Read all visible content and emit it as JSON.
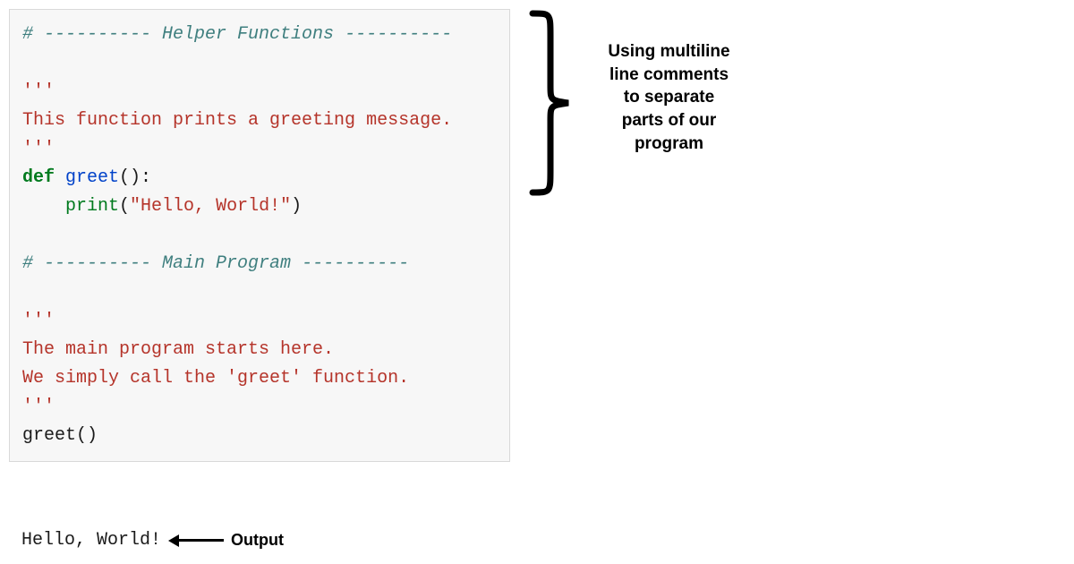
{
  "code": {
    "section1_comment_pre": "# ---------- ",
    "section1_comment_text": "Helper Functions",
    "section1_comment_post": " ----------",
    "blank": "",
    "doc1_open": "'''",
    "doc1_line": "This function prints a greeting message.",
    "doc1_close": "'''",
    "def_kw": "def",
    "def_sp": " ",
    "def_name": "greet",
    "def_parens": "():",
    "print_indent": "    ",
    "print_builtin": "print",
    "print_open": "(",
    "print_str": "\"Hello, World!\"",
    "print_close": ")",
    "section2_comment_pre": "# ---------- ",
    "section2_comment_text": "Main Program",
    "section2_comment_post": " ----------",
    "doc2_open": "'''",
    "doc2_line1": "The main program starts here.",
    "doc2_line2": "We simply call the 'greet' function.",
    "doc2_close": "'''",
    "call_line": "greet()"
  },
  "output": {
    "text": "Hello, World!",
    "label": "Output"
  },
  "annotation": {
    "line1": "Using multiline",
    "line2": "line comments",
    "line3": "to separate",
    "line4": "parts of our",
    "line5": "program"
  }
}
